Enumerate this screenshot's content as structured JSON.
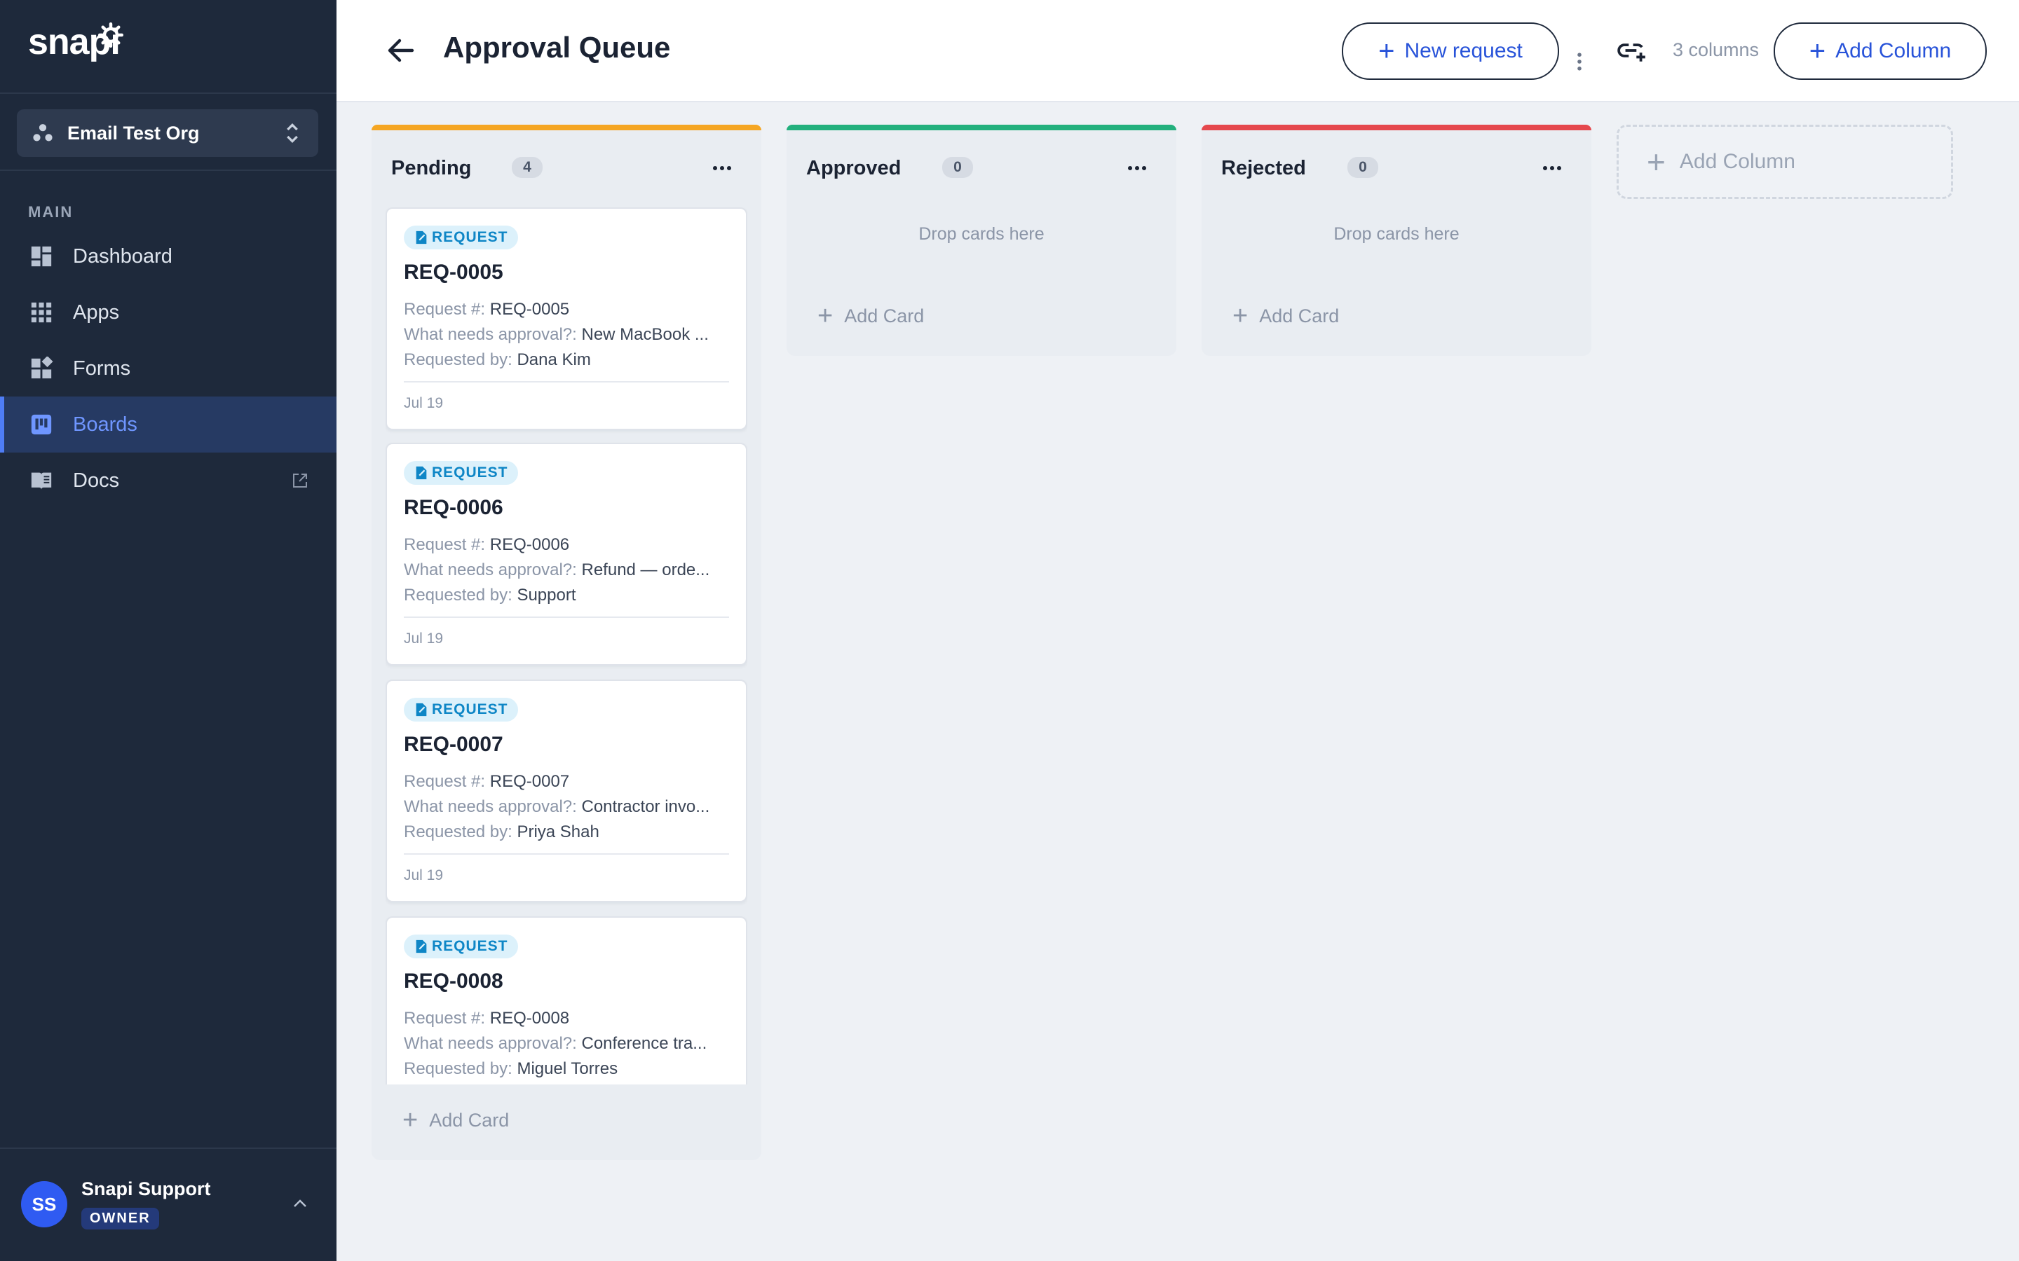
{
  "brand": {
    "logo_text": "snapi"
  },
  "org": {
    "name": "Email Test Org"
  },
  "sidebar": {
    "section": "MAIN",
    "items": [
      {
        "label": "Dashboard",
        "icon": "dashboard-icon"
      },
      {
        "label": "Apps",
        "icon": "apps-grid-icon"
      },
      {
        "label": "Forms",
        "icon": "forms-icon"
      },
      {
        "label": "Boards",
        "icon": "boards-icon",
        "active": true
      },
      {
        "label": "Docs",
        "icon": "docs-book-icon",
        "external": true
      }
    ]
  },
  "user": {
    "initials": "SS",
    "name": "Snapi Support",
    "role": "OWNER"
  },
  "header": {
    "title": "Approval Queue",
    "new_request_label": "New request",
    "columns_count": "3 columns",
    "add_column_label": "Add Column"
  },
  "colors": {
    "pending": "#f5a623",
    "approved": "#22b07d",
    "rejected": "#e5484d",
    "accent": "#2853d9"
  },
  "board": {
    "columns": [
      {
        "title": "Pending",
        "count": "4",
        "cards": [
          {
            "badge": "REQUEST",
            "title": "REQ-0005",
            "f1_label": "Request #:",
            "f1_value": "REQ-0005",
            "f2_label": "What needs approval?:",
            "f2_value": "New MacBook ...",
            "f3_label": "Requested by:",
            "f3_value": "Dana Kim",
            "date": "Jul 19"
          },
          {
            "badge": "REQUEST",
            "title": "REQ-0006",
            "f1_label": "Request #:",
            "f1_value": "REQ-0006",
            "f2_label": "What needs approval?:",
            "f2_value": "Refund — orde...",
            "f3_label": "Requested by:",
            "f3_value": "Support",
            "date": "Jul 19"
          },
          {
            "badge": "REQUEST",
            "title": "REQ-0007",
            "f1_label": "Request #:",
            "f1_value": "REQ-0007",
            "f2_label": "What needs approval?:",
            "f2_value": "Contractor invo...",
            "f3_label": "Requested by:",
            "f3_value": "Priya Shah",
            "date": "Jul 19"
          },
          {
            "badge": "REQUEST",
            "title": "REQ-0008",
            "f1_label": "Request #:",
            "f1_value": "REQ-0008",
            "f2_label": "What needs approval?:",
            "f2_value": "Conference tra...",
            "f3_label": "Requested by:",
            "f3_value": "Miguel Torres",
            "date": ""
          }
        ],
        "add_card": "Add Card"
      },
      {
        "title": "Approved",
        "count": "0",
        "empty": "Drop cards here",
        "add_card": "Add Card"
      },
      {
        "title": "Rejected",
        "count": "0",
        "empty": "Drop cards here",
        "add_card": "Add Card"
      }
    ],
    "add_column_ghost": "Add Column"
  }
}
